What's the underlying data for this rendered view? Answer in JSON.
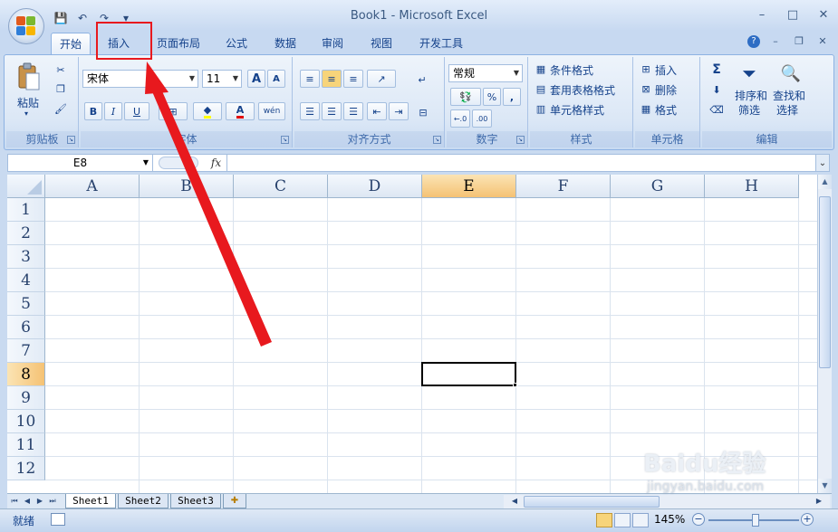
{
  "window": {
    "title": "Book1 - Microsoft Excel",
    "minimize": "–",
    "maximize": "□",
    "close": "✕"
  },
  "qat": {
    "save": "💾",
    "undo": "↶",
    "redo": "↷",
    "customize": "▾"
  },
  "tabs": [
    {
      "label": "开始",
      "active": true
    },
    {
      "label": "插入",
      "active": false
    },
    {
      "label": "页面布局",
      "active": false
    },
    {
      "label": "公式",
      "active": false
    },
    {
      "label": "数据",
      "active": false
    },
    {
      "label": "审阅",
      "active": false
    },
    {
      "label": "视图",
      "active": false
    },
    {
      "label": "开发工具",
      "active": false
    }
  ],
  "doc_controls": {
    "help": "?",
    "minimize": "–",
    "restore": "❐",
    "close": "✕"
  },
  "ribbon": {
    "clipboard": {
      "label": "剪贴板",
      "paste": "粘贴"
    },
    "font": {
      "label": "字体",
      "font_name": "宋体",
      "font_size": "11",
      "grow": "A",
      "shrink": "A",
      "bold": "B",
      "italic": "I",
      "underline": "U",
      "font_color": "A",
      "phonetic": "wén"
    },
    "alignment": {
      "label": "对齐方式"
    },
    "number": {
      "label": "数字",
      "format": "常规",
      "percent": "%",
      "comma": ",",
      "inc_decimal": "←.0",
      "dec_decimal": ".00"
    },
    "styles": {
      "label": "样式",
      "conditional": "条件格式",
      "table": "套用表格格式",
      "cell_styles": "单元格样式"
    },
    "cells": {
      "label": "单元格",
      "insert": "插入",
      "delete": "删除",
      "format": "格式"
    },
    "editing": {
      "label": "编辑",
      "sum": "Σ",
      "sort_l1": "排序和",
      "sort_l2": "筛选",
      "find_l1": "查找和",
      "find_l2": "选择"
    }
  },
  "formula_bar": {
    "name_box": "E8",
    "fx": "fx",
    "content": ""
  },
  "grid": {
    "columns": [
      "A",
      "B",
      "C",
      "D",
      "E",
      "F",
      "G",
      "H"
    ],
    "rows": [
      "1",
      "2",
      "3",
      "4",
      "5",
      "6",
      "7",
      "8",
      "9",
      "10",
      "11",
      "12"
    ],
    "selected_column": "E",
    "selected_row": "8"
  },
  "sheets": [
    {
      "label": "Sheet1",
      "active": true
    },
    {
      "label": "Sheet2",
      "active": false
    },
    {
      "label": "Sheet3",
      "active": false
    }
  ],
  "status": {
    "text": "就绪",
    "zoom": "145%"
  },
  "watermark": {
    "main": "Baidu经验",
    "sub": "jingyan.baidu.com"
  },
  "colors": {
    "highlight": "#e8191e",
    "selected_header": "#f5c274",
    "accent": "#15428b"
  }
}
